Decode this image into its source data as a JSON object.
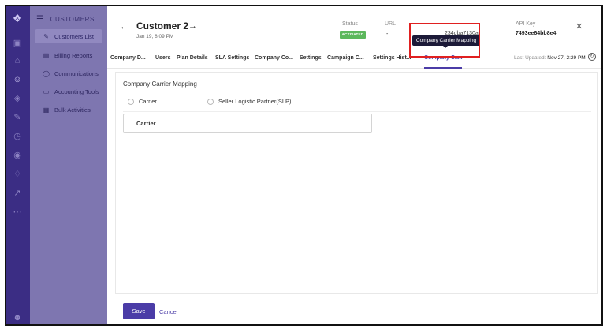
{
  "sidebar": {
    "header": "CUSTOMERS",
    "items": [
      {
        "label": "Customers List",
        "icon": "pen-icon"
      },
      {
        "label": "Billing Reports",
        "icon": "clipboard-icon"
      },
      {
        "label": "Communications",
        "icon": "chat-bubble-icon"
      },
      {
        "label": "Accounting Tools",
        "icon": "card-icon"
      },
      {
        "label": "Bulk Activities",
        "icon": "grid-icon"
      }
    ]
  },
  "header": {
    "title": "Customer 2",
    "date": "Jan 19, 8:09 PM",
    "status_label": "Status",
    "status_badge": "ACTIVATED",
    "url_label": "URL",
    "url_value": "-",
    "obscured_value": "234dba7130a",
    "api_key_label": "API Key",
    "api_key_value": "7493ee64bb8e4"
  },
  "tabs": [
    "Company D...",
    "Users",
    "Plan Details",
    "SLA Settings",
    "Company Co...",
    "Settings",
    "Campaign C...",
    "Settings Hist...",
    "Company Ca..."
  ],
  "last_updated_label": "Last Updated:",
  "last_updated_value": "Nov 27, 2:29 PM",
  "tooltip": "Company Carrier Mapping",
  "content": {
    "section_title": "Company Carrier Mapping",
    "radio_carrier": "Carrier",
    "radio_slp": "Seller Logistic Partner(SLP)",
    "carrier_box_label": "Carrier"
  },
  "footer": {
    "save_label": "Save",
    "cancel_label": "Cancel"
  },
  "colors": {
    "accent": "#4b3ca7",
    "rail": "#3b2d84",
    "sidebar": "#7e76b0",
    "status": "#5cb85c",
    "highlight": "#e02020"
  }
}
